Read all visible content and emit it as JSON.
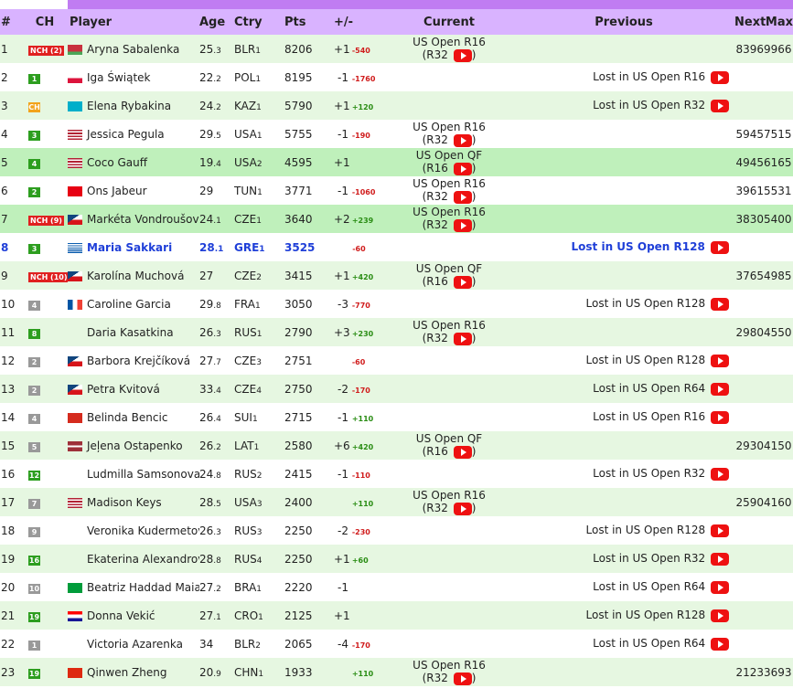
{
  "headers": [
    "#",
    "CH",
    "Player",
    "Age",
    "Ctry",
    "Pts",
    "+/-",
    "Current",
    "Previous",
    "Next",
    "Max"
  ],
  "rows": [
    {
      "rank": "1",
      "ch": "NCH (2)",
      "ch_type": "nch",
      "flag": "by",
      "player": "Aryna Sabalenka",
      "age": "25",
      "age_dec": ".3",
      "ctry": "BLR",
      "ctry_n": "1",
      "pts": "8206",
      "move": "+1",
      "delta": "-540",
      "cur1": "US Open R16",
      "cur2": "(R32",
      "prev": "",
      "next": "8396",
      "max": "9966",
      "style": "odd"
    },
    {
      "rank": "2",
      "ch": "1",
      "ch_type": "g",
      "flag": "pl",
      "player": "Iga Świątek",
      "age": "22",
      "age_dec": ".2",
      "ctry": "POL",
      "ctry_n": "1",
      "pts": "8195",
      "move": "-1",
      "delta": "-1760",
      "cur1": "",
      "cur2": "",
      "prev": "Lost in US Open R16",
      "next": "",
      "max": "",
      "style": "even"
    },
    {
      "rank": "3",
      "ch": "CH",
      "ch_type": "o",
      "flag": "kz",
      "player": "Elena Rybakina",
      "age": "24",
      "age_dec": ".2",
      "ctry": "KAZ",
      "ctry_n": "1",
      "pts": "5790",
      "move": "+1",
      "delta": "+120",
      "cur1": "",
      "cur2": "",
      "prev": "Lost in US Open R32",
      "next": "",
      "max": "",
      "style": "odd"
    },
    {
      "rank": "4",
      "ch": "3",
      "ch_type": "g",
      "flag": "us",
      "player": "Jessica Pegula",
      "age": "29",
      "age_dec": ".5",
      "ctry": "USA",
      "ctry_n": "1",
      "pts": "5755",
      "move": "-1",
      "delta": "-190",
      "cur1": "US Open R16",
      "cur2": "(R32",
      "prev": "",
      "next": "5945",
      "max": "7515",
      "style": "even"
    },
    {
      "rank": "5",
      "ch": "4",
      "ch_type": "g",
      "flag": "us",
      "player": "Coco Gauff",
      "age": "19",
      "age_dec": ".4",
      "ctry": "USA",
      "ctry_n": "2",
      "pts": "4595",
      "move": "+1",
      "delta": "",
      "cur1": "US Open QF",
      "cur2": "(R16",
      "prev": "",
      "next": "4945",
      "max": "6165",
      "style": "dark"
    },
    {
      "rank": "6",
      "ch": "2",
      "ch_type": "g",
      "flag": "tn",
      "player": "Ons Jabeur",
      "age": "29",
      "age_dec": "",
      "ctry": "TUN",
      "ctry_n": "1",
      "pts": "3771",
      "move": "-1",
      "delta": "-1060",
      "cur1": "US Open R16",
      "cur2": "(R32",
      "prev": "",
      "next": "3961",
      "max": "5531",
      "style": "even"
    },
    {
      "rank": "7",
      "ch": "NCH (9)",
      "ch_type": "nch",
      "flag": "cz",
      "player": "Markéta Vondroušová",
      "age": "24",
      "age_dec": ".1",
      "ctry": "CZE",
      "ctry_n": "1",
      "pts": "3640",
      "move": "+2",
      "delta": "+239",
      "cur1": "US Open R16",
      "cur2": "(R32",
      "prev": "",
      "next": "3830",
      "max": "5400",
      "style": "dark"
    },
    {
      "rank": "8",
      "ch": "3",
      "ch_type": "g",
      "flag": "gr",
      "player": "Maria Sakkari",
      "age": "28",
      "age_dec": ".1",
      "ctry": "GRE",
      "ctry_n": "1",
      "pts": "3525",
      "move": "",
      "delta": "-60",
      "cur1": "",
      "cur2": "",
      "prev": "Lost in US Open R128",
      "next": "",
      "max": "",
      "style": "hl"
    },
    {
      "rank": "9",
      "ch": "NCH (10)",
      "ch_type": "nch",
      "flag": "cz",
      "player": "Karolína Muchová",
      "age": "27",
      "age_dec": "",
      "ctry": "CZE",
      "ctry_n": "2",
      "pts": "3415",
      "move": "+1",
      "delta": "+420",
      "cur1": "US Open QF",
      "cur2": "(R16",
      "prev": "",
      "next": "3765",
      "max": "4985",
      "style": "odd"
    },
    {
      "rank": "10",
      "ch": "4",
      "ch_type": "gr",
      "flag": "fr",
      "player": "Caroline Garcia",
      "age": "29",
      "age_dec": ".8",
      "ctry": "FRA",
      "ctry_n": "1",
      "pts": "3050",
      "move": "-3",
      "delta": "-770",
      "cur1": "",
      "cur2": "",
      "prev": "Lost in US Open R128",
      "next": "",
      "max": "",
      "style": "even"
    },
    {
      "rank": "11",
      "ch": "8",
      "ch_type": "g",
      "flag": "",
      "player": "Daria Kasatkina",
      "age": "26",
      "age_dec": ".3",
      "ctry": "RUS",
      "ctry_n": "1",
      "pts": "2790",
      "move": "+3",
      "delta": "+230",
      "cur1": "US Open R16",
      "cur2": "(R32",
      "prev": "",
      "next": "2980",
      "max": "4550",
      "style": "odd"
    },
    {
      "rank": "12",
      "ch": "2",
      "ch_type": "gr",
      "flag": "cz",
      "player": "Barbora Krejčíková",
      "age": "27",
      "age_dec": ".7",
      "ctry": "CZE",
      "ctry_n": "3",
      "pts": "2751",
      "move": "",
      "delta": "-60",
      "cur1": "",
      "cur2": "",
      "prev": "Lost in US Open R128",
      "next": "",
      "max": "",
      "style": "even"
    },
    {
      "rank": "13",
      "ch": "2",
      "ch_type": "gr",
      "flag": "cz",
      "player": "Petra Kvitová",
      "age": "33",
      "age_dec": ".4",
      "ctry": "CZE",
      "ctry_n": "4",
      "pts": "2750",
      "move": "-2",
      "delta": "-170",
      "cur1": "",
      "cur2": "",
      "prev": "Lost in US Open R64",
      "next": "",
      "max": "",
      "style": "odd"
    },
    {
      "rank": "14",
      "ch": "4",
      "ch_type": "gr",
      "flag": "ch",
      "player": "Belinda Bencic",
      "age": "26",
      "age_dec": ".4",
      "ctry": "SUI",
      "ctry_n": "1",
      "pts": "2715",
      "move": "-1",
      "delta": "+110",
      "cur1": "",
      "cur2": "",
      "prev": "Lost in US Open R16",
      "next": "",
      "max": "",
      "style": "even"
    },
    {
      "rank": "15",
      "ch": "5",
      "ch_type": "gr",
      "flag": "lv",
      "player": "Jeļena Ostapenko",
      "age": "26",
      "age_dec": ".2",
      "ctry": "LAT",
      "ctry_n": "1",
      "pts": "2580",
      "move": "+6",
      "delta": "+420",
      "cur1": "US Open QF",
      "cur2": "(R16",
      "prev": "",
      "next": "2930",
      "max": "4150",
      "style": "odd"
    },
    {
      "rank": "16",
      "ch": "12",
      "ch_type": "g",
      "flag": "",
      "player": "Ludmilla Samsonova",
      "age": "24",
      "age_dec": ".8",
      "ctry": "RUS",
      "ctry_n": "2",
      "pts": "2415",
      "move": "-1",
      "delta": "-110",
      "cur1": "",
      "cur2": "",
      "prev": "Lost in US Open R32",
      "next": "",
      "max": "",
      "style": "even"
    },
    {
      "rank": "17",
      "ch": "7",
      "ch_type": "gr",
      "flag": "us",
      "player": "Madison Keys",
      "age": "28",
      "age_dec": ".5",
      "ctry": "USA",
      "ctry_n": "3",
      "pts": "2400",
      "move": "",
      "delta": "+110",
      "cur1": "US Open R16",
      "cur2": "(R32",
      "prev": "",
      "next": "2590",
      "max": "4160",
      "style": "odd"
    },
    {
      "rank": "18",
      "ch": "9",
      "ch_type": "gr",
      "flag": "",
      "player": "Veronika Kudermetova",
      "age": "26",
      "age_dec": ".3",
      "ctry": "RUS",
      "ctry_n": "3",
      "pts": "2250",
      "move": "-2",
      "delta": "-230",
      "cur1": "",
      "cur2": "",
      "prev": "Lost in US Open R128",
      "next": "",
      "max": "",
      "style": "even"
    },
    {
      "rank": "19",
      "ch": "16",
      "ch_type": "g",
      "flag": "",
      "player": "Ekaterina Alexandrova",
      "age": "28",
      "age_dec": ".8",
      "ctry": "RUS",
      "ctry_n": "4",
      "pts": "2250",
      "move": "+1",
      "delta": "+60",
      "cur1": "",
      "cur2": "",
      "prev": "Lost in US Open R32",
      "next": "",
      "max": "",
      "style": "odd"
    },
    {
      "rank": "20",
      "ch": "10",
      "ch_type": "gr",
      "flag": "br",
      "player": "Beatriz Haddad Maia",
      "age": "27",
      "age_dec": ".2",
      "ctry": "BRA",
      "ctry_n": "1",
      "pts": "2220",
      "move": "-1",
      "delta": "",
      "cur1": "",
      "cur2": "",
      "prev": "Lost in US Open R64",
      "next": "",
      "max": "",
      "style": "even"
    },
    {
      "rank": "21",
      "ch": "19",
      "ch_type": "g",
      "flag": "hr",
      "player": "Donna Vekić",
      "age": "27",
      "age_dec": ".1",
      "ctry": "CRO",
      "ctry_n": "1",
      "pts": "2125",
      "move": "+1",
      "delta": "",
      "cur1": "",
      "cur2": "",
      "prev": "Lost in US Open R128",
      "next": "",
      "max": "",
      "style": "odd"
    },
    {
      "rank": "22",
      "ch": "1",
      "ch_type": "gr",
      "flag": "",
      "player": "Victoria Azarenka",
      "age": "34",
      "age_dec": "",
      "ctry": "BLR",
      "ctry_n": "2",
      "pts": "2065",
      "move": "-4",
      "delta": "-170",
      "cur1": "",
      "cur2": "",
      "prev": "Lost in US Open R64",
      "next": "",
      "max": "",
      "style": "even"
    },
    {
      "rank": "23",
      "ch": "19",
      "ch_type": "g",
      "flag": "cn",
      "player": "Qinwen Zheng",
      "age": "20",
      "age_dec": ".9",
      "ctry": "CHN",
      "ctry_n": "1",
      "pts": "1933",
      "move": "",
      "delta": "+110",
      "cur1": "US Open R16",
      "cur2": "(R32",
      "prev": "",
      "next": "2123",
      "max": "3693",
      "style": "odd"
    }
  ],
  "colors": {
    "header_bg": "#d9b3ff",
    "header_accent": "#c07cf2",
    "row_green": "#e6f7e1",
    "row_dark_green": "#bff0bb",
    "highlight_text": "#1f3fd8",
    "youtube_red": "#ee1111"
  }
}
